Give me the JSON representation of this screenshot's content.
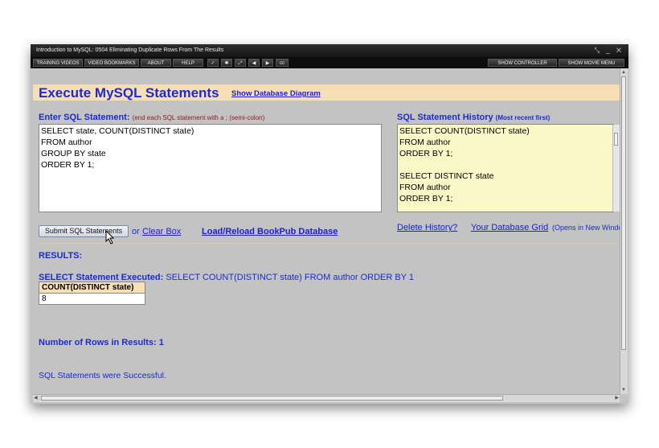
{
  "window": {
    "title": "Introduction to MySQL: 0504 Eliminating Duplicate Rows From The Results",
    "controls": "⤡ _ ✕"
  },
  "menubar": {
    "items": [
      "TRAINING VIDEOS",
      "VIDEO BOOKMARKS",
      "ABOUT",
      "HELP"
    ],
    "icons": [
      "✓",
      "✱",
      "⤢",
      "◀",
      "▶",
      "cc"
    ],
    "right": [
      "SHOW CONTROLLER",
      "SHOW MOVIE MENU"
    ]
  },
  "page": {
    "heading": "Execute MySQL Statements",
    "diagram_link": "Show Database Diagram",
    "enter_label": "Enter SQL Statement:",
    "enter_note": "(end each SQL statement with a ; (semi-colon)",
    "sql_input": "SELECT state, COUNT(DISTINCT state)\nFROM author\nGROUP BY state\nORDER BY 1;",
    "history_label": "SQL Statement History",
    "history_note": "(Most recent first)",
    "history_text": "SELECT COUNT(DISTINCT state)\nFROM author\nORDER BY 1;\n\nSELECT DISTINCT state\nFROM author\nORDER BY 1;",
    "submit_button": "Submit SQL Statements",
    "or_text": "or",
    "clear_link": "Clear Box",
    "reload_link": "Load/Reload BookPub Database",
    "delete_history_link": "Delete History?",
    "grid_link": "Your Database Grid",
    "grid_note": "(Opens in New Windo",
    "results_label": "RESULTS:",
    "executed_label": "SELECT Statement Executed:",
    "executed_sql": "SELECT COUNT(DISTINCT state) FROM author ORDER BY 1",
    "result_table": {
      "columns": [
        "COUNT(DISTINCT state)"
      ],
      "rows": [
        [
          "8"
        ]
      ]
    },
    "rows_label": "Number of Rows in Results: 1",
    "success_msg": "SQL Statements were Successful."
  },
  "colors": {
    "accent_blue": "#1d2bd0",
    "header_band": "#f6dfb5",
    "history_bg": "#fbf8c8",
    "note_red": "#8a2020"
  }
}
